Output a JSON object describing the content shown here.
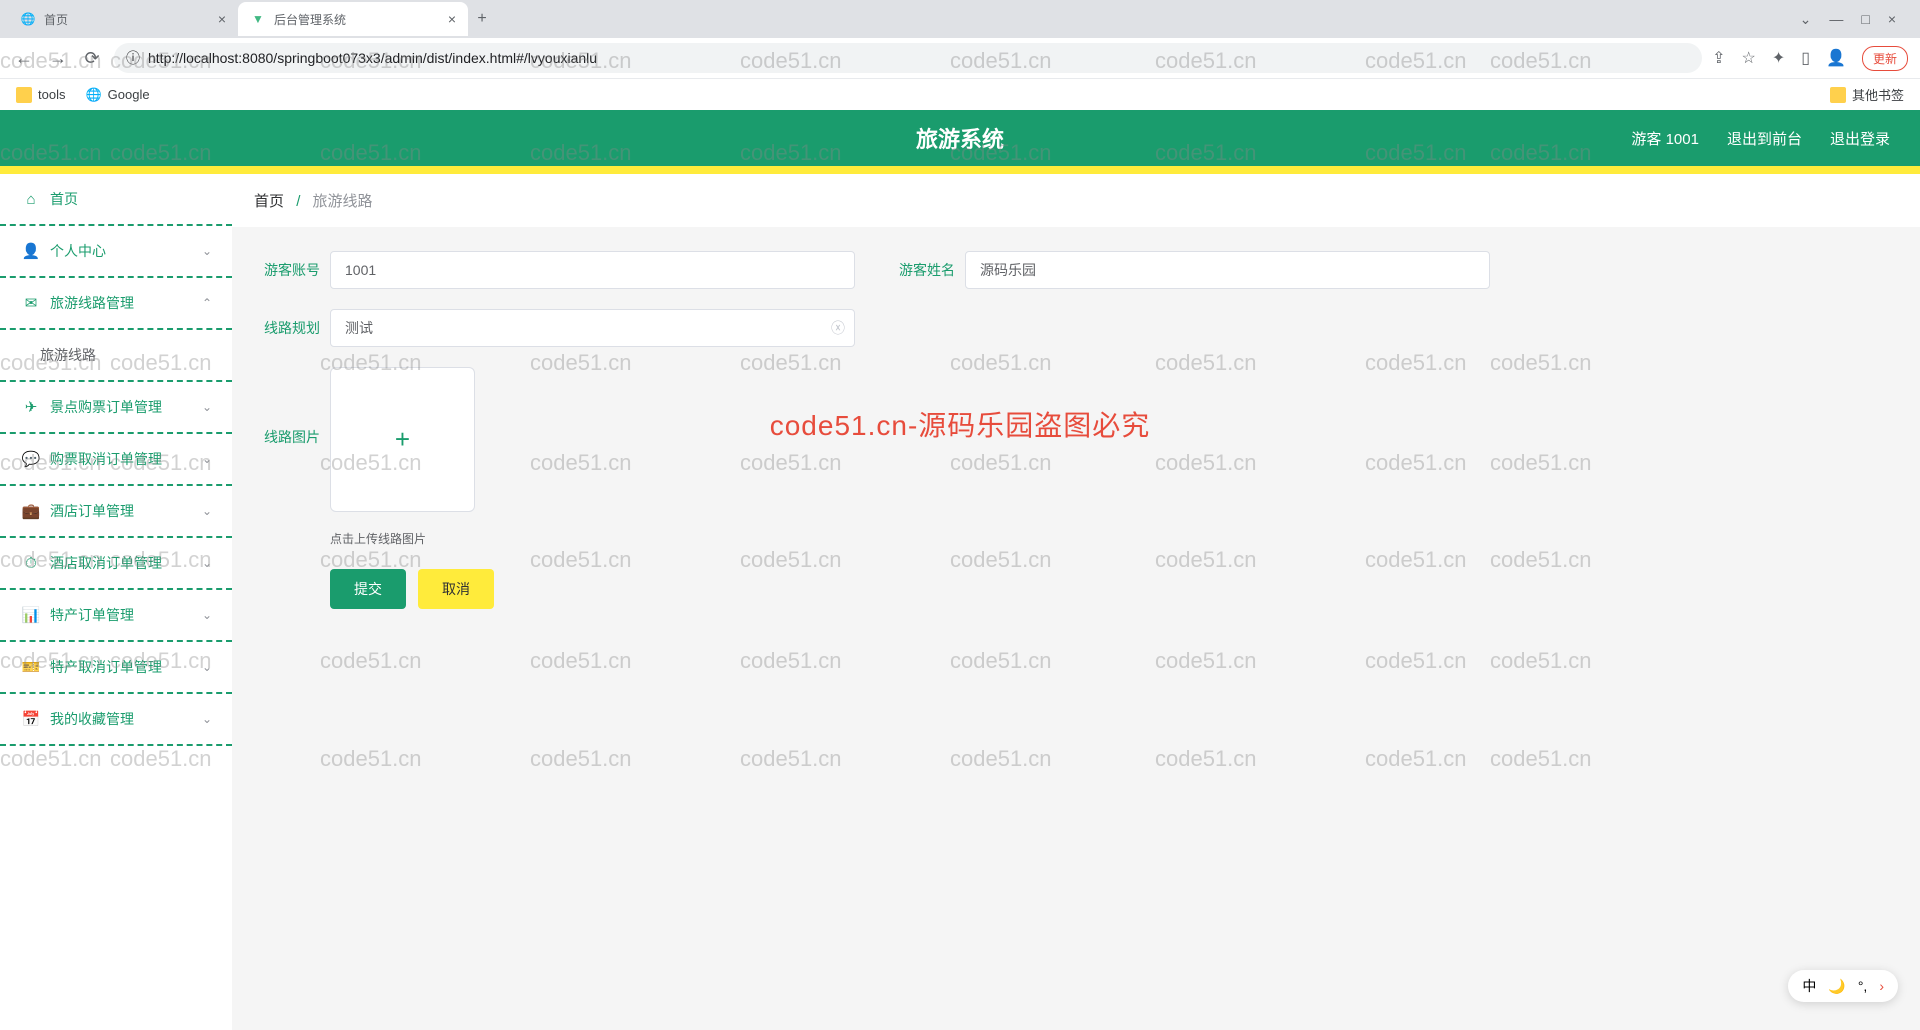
{
  "browser": {
    "tabs": [
      {
        "title": "首页",
        "active": false
      },
      {
        "title": "后台管理系统",
        "active": true
      }
    ],
    "url": "http://localhost:8080/springboot073x3/admin/dist/index.html#/lvyouxianlu",
    "update_label": "更新",
    "bookmarks": {
      "tools": "tools",
      "google": "Google",
      "other": "其他书签"
    }
  },
  "header": {
    "title": "旅游系统",
    "user": "游客 1001",
    "exit_front": "退出到前台",
    "logout": "退出登录"
  },
  "sidebar": {
    "home": "首页",
    "personal": "个人中心",
    "route_mgmt": "旅游线路管理",
    "route": "旅游线路",
    "ticket_order": "景点购票订单管理",
    "ticket_cancel": "购票取消订单管理",
    "hotel_order": "酒店订单管理",
    "hotel_cancel": "酒店取消订单管理",
    "specialty_order": "特产订单管理",
    "specialty_cancel": "特产取消订单管理",
    "favorites": "我的收藏管理"
  },
  "breadcrumb": {
    "home": "首页",
    "current": "旅游线路"
  },
  "form": {
    "account_label": "游客账号",
    "account_value": "1001",
    "name_label": "游客姓名",
    "name_value": "源码乐园",
    "plan_label": "线路规划",
    "plan_value": "测试",
    "image_label": "线路图片",
    "upload_hint": "点击上传线路图片",
    "submit": "提交",
    "cancel": "取消"
  },
  "watermark": {
    "text": "code51.cn",
    "main": "code51.cn-源码乐园盗图必究"
  },
  "ime": {
    "lang": "中",
    "moon": "🌙",
    "dots": "᠁"
  }
}
